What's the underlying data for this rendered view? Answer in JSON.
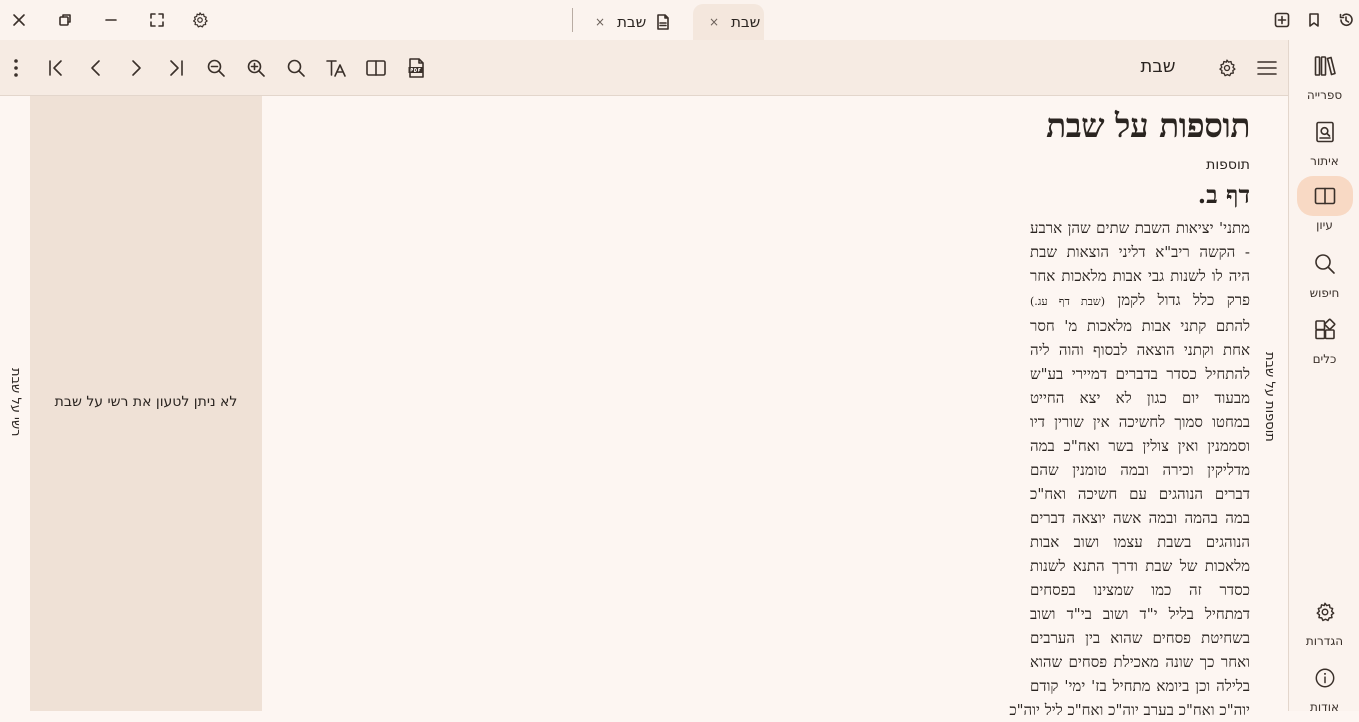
{
  "titlebar": {
    "tabs": [
      {
        "label": "שבת",
        "active": true
      },
      {
        "label": "שבת",
        "active": false,
        "has_pdf_icon": true
      }
    ],
    "close_tab_glyph": "×",
    "icons": {
      "window_close": "close-icon",
      "window_restore": "restore-icon",
      "window_minimize": "minimize-icon",
      "window_fullscreen": "fullscreen-icon",
      "window_settings": "gear-icon",
      "new_tab": "add-tab-icon",
      "bookmark": "bookmark-icon",
      "history": "history-icon"
    }
  },
  "toolbar": {
    "book_title": "שבת",
    "icons": [
      "more-vert-icon",
      "first-page-icon",
      "prev-icon",
      "next-icon",
      "last-page-icon",
      "zoom-out-icon",
      "zoom-in-icon",
      "search-icon",
      "font-size-icon",
      "split-view-icon",
      "pdf-icon",
      "gear-icon",
      "menu-icon"
    ]
  },
  "nav": {
    "items": [
      {
        "label": "ספרייה",
        "icon": "library-icon",
        "active": false
      },
      {
        "label": "איתור",
        "icon": "locate-icon",
        "active": false
      },
      {
        "label": "עיון",
        "icon": "book-open-icon",
        "active": true
      },
      {
        "label": "חיפוש",
        "icon": "search-icon",
        "active": false
      },
      {
        "label": "כלים",
        "icon": "tools-icon",
        "active": false
      }
    ],
    "bottom_items": [
      {
        "label": "הגדרות",
        "icon": "gear-icon"
      },
      {
        "label": "אודות",
        "icon": "info-icon"
      }
    ]
  },
  "side_tabs": {
    "right": "תוספות על שבת",
    "left": "רשי על שבת"
  },
  "commentary_panel": {
    "message": "לא ניתן לטעון את רשי על שבת"
  },
  "main": {
    "heading": "תוספות על שבת",
    "subheading": "תוספות",
    "daf": "דף ב.",
    "body_lines": [
      "מתני' יציאות השבת שתים שהן ארבע",
      "- הקשה ריב\"א דליני הוצאות שבת",
      "היה לו לשנות גבי אבות מלאכות אחר",
      "פרק כלל גדול לקמן",
      "להתם קתני אבות מלאכות מ' חסר",
      "אחת וקתני הוצאה לבסוף והוה ליה",
      "להתחיל כסדר בדברים דמיירי בע\"ש",
      "מבעוד יום כגון לא יצא החייט",
      "במחטו סמוך לחשיכה אין שורין דיו",
      "וסממנין ואין צולין בשר ואח\"כ במה",
      "מדליקין וכירה ובמה טומנין שהם",
      "דברים הנוהגים עם חשיכה ואח\"כ",
      "במה בהמה ובמה אשה יוצאה דברים",
      "הנוהגים בשבת עצמו ושוב אבות",
      "מלאכות של שבת ודרך התנא לשנות",
      "כסדר זה כמו שמצינו בפסחים",
      "דמתחיל בליל י\"ד ושוב בי\"ד ושוב",
      "בשחיטת פסחים שהוא בין הערבים",
      "ואחר כך שונה מאכילת פסחים שהוא",
      "בלילה וכן ביומא מתחיל בז' ימי' קודם",
      "יוה\"כ ואח\"כ בערב יוה\"כ ואח\"כ ליל יוה\"כ"
    ],
    "body_ref": "(שבת דף עג.)"
  }
}
